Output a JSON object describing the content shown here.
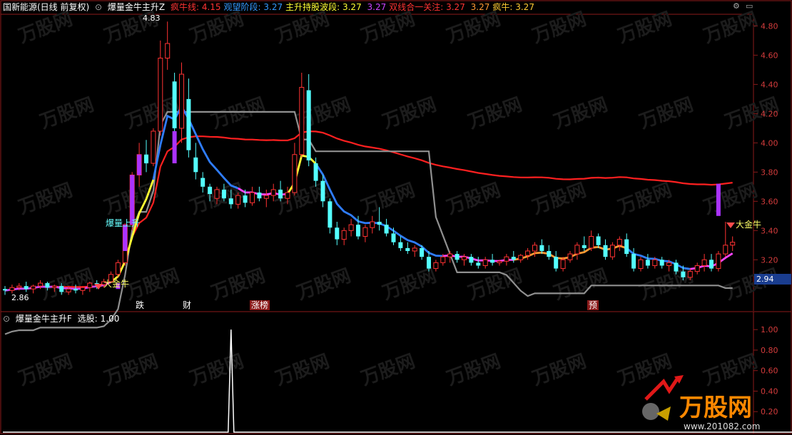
{
  "header_main": {
    "stock": "国新能源(日线 前复权)",
    "indicator": "爆量金牛主升Z",
    "items": [
      {
        "label": "疯牛线:",
        "value": "4.15",
        "color": "#ff3333"
      },
      {
        "label": "观望阶段:",
        "value": "3.27",
        "color": "#3399ff"
      },
      {
        "label": "主升持股波段:",
        "value": "3.27",
        "color": "#ffff33"
      },
      {
        "label": "",
        "value": "3.27",
        "color": "#cc44ff"
      },
      {
        "label": "双线合一关注:",
        "value": "3.27",
        "color": "#ff3333"
      },
      {
        "label": "",
        "value": "3.27",
        "color": "#ff9933"
      },
      {
        "label": "疯牛:",
        "value": "3.27",
        "color": "#ffcc33"
      }
    ]
  },
  "header_sub": {
    "indicator": "爆量金牛主升F",
    "label": "选股:",
    "value": "1.00"
  },
  "labels": {
    "max_price": "4.83",
    "min_price": "2.86",
    "current_price": "2.94",
    "baoliang": "爆量上升",
    "dajinniu_1": "大金牛",
    "dajinniu_2": "大金牛",
    "events": [
      {
        "text": "跌",
        "color": "#ffffff"
      },
      {
        "text": "财",
        "color": "#ffffff"
      },
      {
        "text": "涨榜",
        "color": "#ffffff"
      },
      {
        "text": "预",
        "color": "#ffffff"
      }
    ],
    "watermark": "万股网",
    "watermark_url": "www.201082.com"
  },
  "chart_data": [
    {
      "type": "candlestick",
      "yticks": [
        "4.80",
        "4.60",
        "4.40",
        "4.20",
        "4.00",
        "3.80",
        "3.60",
        "3.40",
        "3.20"
      ],
      "ylim": [
        2.85,
        4.88
      ],
      "candles": [
        [
          3.0,
          3.02,
          2.96,
          2.99
        ],
        [
          2.99,
          3.03,
          2.97,
          3.01
        ],
        [
          3.01,
          3.04,
          2.99,
          3.02
        ],
        [
          3.02,
          3.05,
          2.98,
          3.0
        ],
        [
          3.0,
          3.03,
          2.97,
          3.02
        ],
        [
          3.02,
          3.06,
          3.0,
          3.04
        ],
        [
          3.04,
          3.05,
          2.99,
          3.01
        ],
        [
          3.01,
          3.03,
          2.98,
          3.02
        ],
        [
          3.02,
          3.04,
          2.96,
          2.98
        ],
        [
          2.98,
          3.02,
          2.96,
          3.0
        ],
        [
          3.0,
          3.03,
          2.97,
          2.99
        ],
        [
          2.99,
          3.02,
          2.96,
          3.01
        ],
        [
          3.01,
          3.05,
          2.98,
          3.04
        ],
        [
          3.04,
          3.06,
          3.0,
          3.03
        ],
        [
          3.03,
          3.07,
          3.01,
          3.05
        ],
        [
          3.05,
          3.12,
          3.04,
          3.1
        ],
        [
          3.1,
          3.2,
          3.08,
          3.18
        ],
        [
          3.18,
          3.45,
          3.16,
          3.44
        ],
        [
          3.44,
          3.8,
          3.4,
          3.78
        ],
        [
          3.78,
          4.0,
          3.7,
          3.92
        ],
        [
          3.92,
          4.02,
          3.8,
          3.86
        ],
        [
          3.86,
          4.1,
          3.84,
          4.08
        ],
        [
          4.08,
          4.7,
          4.05,
          4.58
        ],
        [
          4.58,
          4.83,
          4.5,
          4.68
        ],
        [
          4.42,
          4.48,
          4.05,
          4.1
        ],
        [
          4.1,
          4.55,
          4.0,
          4.47
        ],
        [
          4.3,
          4.44,
          3.9,
          3.95
        ],
        [
          3.9,
          4.0,
          3.75,
          3.8
        ],
        [
          3.76,
          3.8,
          3.66,
          3.7
        ],
        [
          3.7,
          3.72,
          3.6,
          3.65
        ],
        [
          3.62,
          3.7,
          3.58,
          3.68
        ],
        [
          3.68,
          3.72,
          3.6,
          3.62
        ],
        [
          3.62,
          3.68,
          3.55,
          3.58
        ],
        [
          3.58,
          3.66,
          3.55,
          3.64
        ],
        [
          3.64,
          3.68,
          3.56,
          3.59
        ],
        [
          3.59,
          3.7,
          3.57,
          3.66
        ],
        [
          3.66,
          3.7,
          3.6,
          3.62
        ],
        [
          3.62,
          3.68,
          3.56,
          3.64
        ],
        [
          3.64,
          3.72,
          3.6,
          3.68
        ],
        [
          3.68,
          3.74,
          3.6,
          3.62
        ],
        [
          3.62,
          3.7,
          3.58,
          3.66
        ],
        [
          3.66,
          4.0,
          3.64,
          3.92
        ],
        [
          3.92,
          4.48,
          3.9,
          4.38
        ],
        [
          4.36,
          4.47,
          3.84,
          3.88
        ],
        [
          3.86,
          3.9,
          3.7,
          3.74
        ],
        [
          3.74,
          3.78,
          3.56,
          3.6
        ],
        [
          3.6,
          3.62,
          3.38,
          3.42
        ],
        [
          3.42,
          3.46,
          3.3,
          3.34
        ],
        [
          3.34,
          3.42,
          3.3,
          3.4
        ],
        [
          3.4,
          3.48,
          3.36,
          3.44
        ],
        [
          3.44,
          3.5,
          3.34,
          3.36
        ],
        [
          3.36,
          3.44,
          3.32,
          3.42
        ],
        [
          3.42,
          3.5,
          3.38,
          3.46
        ],
        [
          3.46,
          3.56,
          3.4,
          3.44
        ],
        [
          3.44,
          3.48,
          3.36,
          3.38
        ],
        [
          3.38,
          3.42,
          3.3,
          3.32
        ],
        [
          3.32,
          3.36,
          3.26,
          3.28
        ],
        [
          3.28,
          3.32,
          3.24,
          3.26
        ],
        [
          3.26,
          3.3,
          3.22,
          3.28
        ],
        [
          3.28,
          3.3,
          3.2,
          3.22
        ],
        [
          3.22,
          3.26,
          3.12,
          3.14
        ],
        [
          3.14,
          3.2,
          3.12,
          3.18
        ],
        [
          3.18,
          3.24,
          3.16,
          3.22
        ],
        [
          3.22,
          3.26,
          3.18,
          3.24
        ],
        [
          3.24,
          3.26,
          3.18,
          3.2
        ],
        [
          3.2,
          3.24,
          3.16,
          3.22
        ],
        [
          3.22,
          3.24,
          3.16,
          3.18
        ],
        [
          3.18,
          3.22,
          3.14,
          3.16
        ],
        [
          3.16,
          3.22,
          3.14,
          3.2
        ],
        [
          3.2,
          3.24,
          3.16,
          3.18
        ],
        [
          3.18,
          3.2,
          3.16,
          3.19
        ],
        [
          3.19,
          3.24,
          3.16,
          3.22
        ],
        [
          3.22,
          3.26,
          3.18,
          3.2
        ],
        [
          3.2,
          3.24,
          3.18,
          3.23
        ],
        [
          3.23,
          3.28,
          3.2,
          3.26
        ],
        [
          3.26,
          3.32,
          3.22,
          3.3
        ],
        [
          3.3,
          3.34,
          3.24,
          3.26
        ],
        [
          3.26,
          3.3,
          3.2,
          3.22
        ],
        [
          3.22,
          3.26,
          3.12,
          3.14
        ],
        [
          3.14,
          3.22,
          3.12,
          3.2
        ],
        [
          3.2,
          3.26,
          3.18,
          3.24
        ],
        [
          3.24,
          3.32,
          3.2,
          3.3
        ],
        [
          3.3,
          3.36,
          3.26,
          3.28
        ],
        [
          3.28,
          3.4,
          3.26,
          3.36
        ],
        [
          3.36,
          3.38,
          3.28,
          3.3
        ],
        [
          3.3,
          3.34,
          3.2,
          3.22
        ],
        [
          3.22,
          3.32,
          3.2,
          3.3
        ],
        [
          3.3,
          3.36,
          3.26,
          3.34
        ],
        [
          3.34,
          3.38,
          3.22,
          3.24
        ],
        [
          3.24,
          3.28,
          3.12,
          3.14
        ],
        [
          3.14,
          3.22,
          3.12,
          3.2
        ],
        [
          3.2,
          3.24,
          3.14,
          3.16
        ],
        [
          3.16,
          3.22,
          3.14,
          3.2
        ],
        [
          3.2,
          3.22,
          3.14,
          3.16
        ],
        [
          3.16,
          3.2,
          3.12,
          3.18
        ],
        [
          3.18,
          3.2,
          3.1,
          3.12
        ],
        [
          3.12,
          3.16,
          3.06,
          3.08
        ],
        [
          3.08,
          3.14,
          3.06,
          3.12
        ],
        [
          3.12,
          3.18,
          3.1,
          3.16
        ],
        [
          3.16,
          3.24,
          3.12,
          3.2
        ],
        [
          3.2,
          3.24,
          3.12,
          3.14
        ],
        [
          3.14,
          3.26,
          3.12,
          3.24
        ],
        [
          3.24,
          3.46,
          3.22,
          3.3
        ],
        [
          3.3,
          3.36,
          3.26,
          3.32
        ]
      ]
    },
    {
      "type": "line",
      "title": "爆量金牛主升F",
      "yticks": [
        "1.00",
        "0.80",
        "0.60",
        "0.40",
        "0.20"
      ],
      "ylim": [
        0,
        1.05
      ],
      "signals_at_candle": [
        18,
        102
      ]
    }
  ]
}
